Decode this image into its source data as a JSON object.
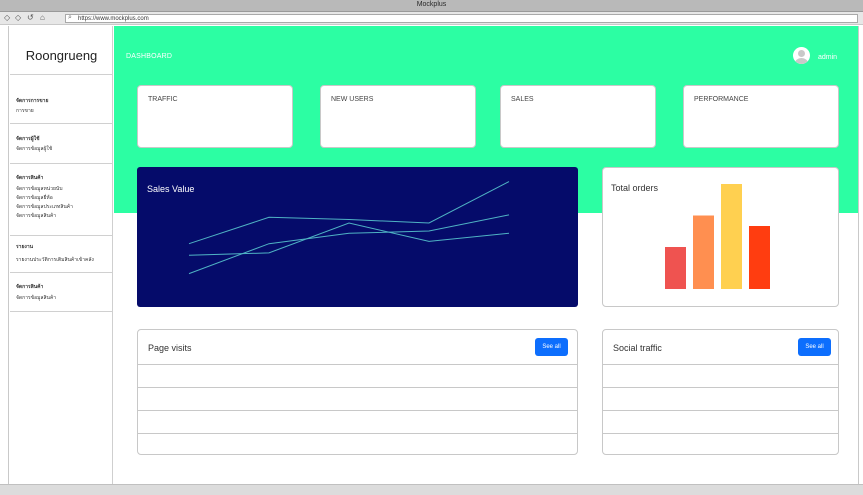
{
  "window": {
    "title": "Mockplus",
    "url": "https://www.mockplus.com"
  },
  "sidebar": {
    "brand": "Roongrueng",
    "groups": [
      {
        "heading": "จัดการการขาย",
        "items": [
          "การขาย"
        ]
      },
      {
        "heading": "จัดการผู้ใช้",
        "items": [
          "จัดการข้อมูลผู้ใช้"
        ]
      },
      {
        "heading": "จัดการสินค้า",
        "items": [
          "จัดการข้อมูลหน่วยนับ",
          "จัดการข้อมูลยี่ห้อ",
          "จัดการข้อมูลประเภทสินค้า",
          "จัดการข้อมูลสินค้า"
        ]
      },
      {
        "heading": "รายงาน",
        "items": [
          "รายงานประวัติการเติมสินค้าเข้าคลัง"
        ]
      },
      {
        "heading": "จัดการสินค้า",
        "items": [
          "จัดการข้อมูลสินค้า"
        ]
      }
    ]
  },
  "header": {
    "title": "DASHBOARD",
    "user": "admin"
  },
  "stat_cards": [
    {
      "label": "TRAFFIC"
    },
    {
      "label": "NEW USERS"
    },
    {
      "label": "SALES"
    },
    {
      "label": "PERFORMANCE"
    }
  ],
  "sales_value": {
    "title": "Sales Value",
    "line_color": "#4fb3c4",
    "background": "#050b6a"
  },
  "total_orders": {
    "title": "Total orders",
    "bar_colors": [
      "#ef5350",
      "#ff8f50",
      "#ffd050",
      "#ff3d10"
    ]
  },
  "page_visits": {
    "title": "Page visits",
    "button": "See all",
    "rows": 4
  },
  "social_traffic": {
    "title": "Social traffic",
    "button": "See all",
    "rows": 4
  },
  "colors": {
    "accent": "#2cfea3",
    "button": "#0d6efd"
  },
  "chart_data": [
    {
      "type": "line",
      "title": "Sales Value",
      "x": [
        0,
        1,
        2,
        3,
        4
      ],
      "series": [
        {
          "values": [
            3.2,
            3.4,
            6.0,
            4.4,
            5.1
          ]
        },
        {
          "values": [
            4.2,
            6.5,
            6.3,
            6.0,
            9.6
          ]
        },
        {
          "values": [
            1.6,
            4.2,
            5.1,
            5.3,
            6.7
          ]
        }
      ],
      "ylim": [
        0,
        10
      ],
      "grid": false
    },
    {
      "type": "bar",
      "title": "Total orders",
      "categories": [
        "",
        "",
        "",
        ""
      ],
      "values": [
        40,
        70,
        100,
        60
      ],
      "ylim": [
        0,
        100
      ]
    }
  ]
}
